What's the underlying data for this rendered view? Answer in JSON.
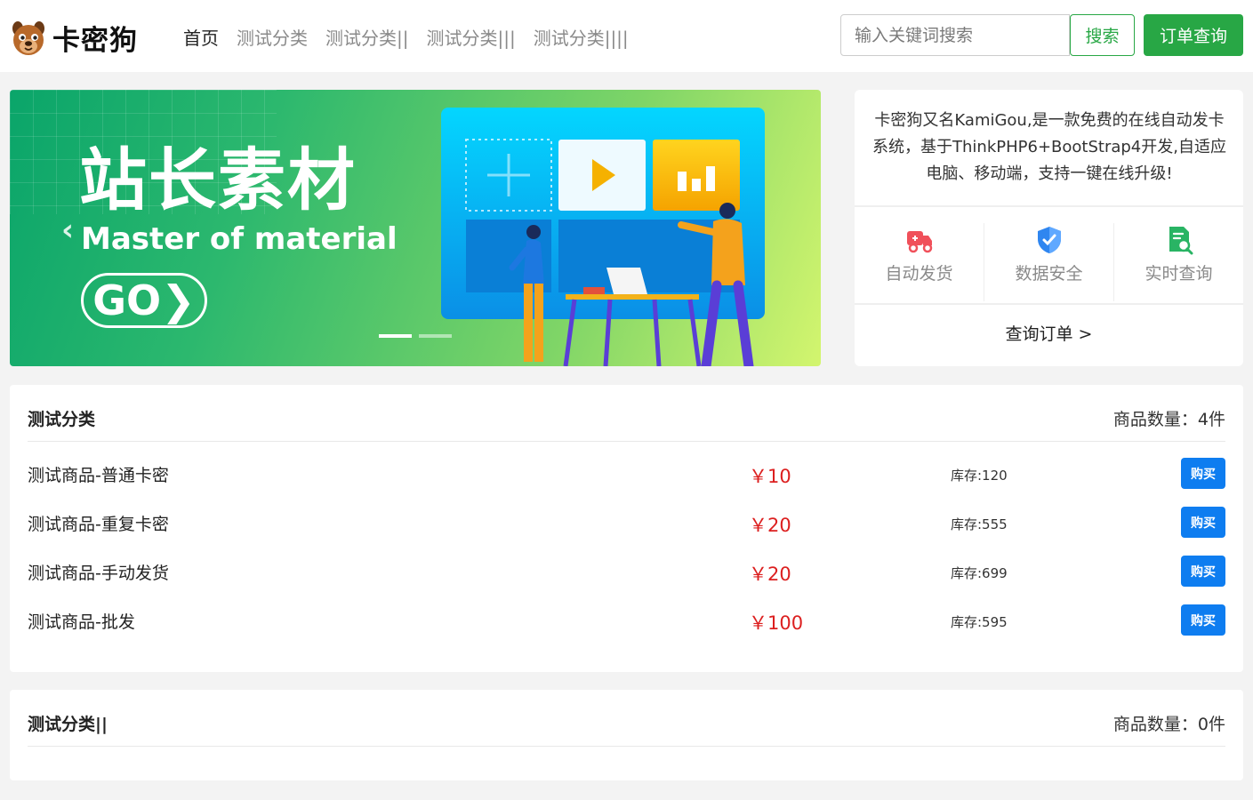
{
  "header": {
    "logo_text": "卡密狗",
    "nav": [
      "首页",
      "测试分类",
      "测试分类||",
      "测试分类|||",
      "测试分类||||"
    ],
    "search_placeholder": "输入关键词搜索",
    "search_label": "搜索",
    "order_query_label": "订单查询"
  },
  "banner": {
    "title": "站长素材",
    "subtitle": "Master of material",
    "go_label": "GO❯",
    "prev_label": "‹",
    "next_label": "›",
    "slide_count": 2,
    "active_slide": 0
  },
  "info": {
    "description": "卡密狗又名KamiGou,是一款免费的在线自动发卡系统，基于ThinkPHP6+BootStrap4开发,自适应电脑、移动端，支持一键在线升级!",
    "features": [
      {
        "label": "自动发货",
        "icon": "delivery-truck-icon"
      },
      {
        "label": "数据安全",
        "icon": "shield-check-icon"
      },
      {
        "label": "实时查询",
        "icon": "document-search-icon"
      }
    ],
    "query_link": "查询订单 >"
  },
  "colors": {
    "brand_green": "#28a745",
    "buy_blue": "#0e7df0",
    "price_red": "#dc1f1f",
    "truck_red": "#f0505a",
    "shield_blue": "#2f86f0",
    "doc_green": "#29b464"
  },
  "sections": [
    {
      "title": "测试分类",
      "count": "商品数量：4件",
      "products": [
        {
          "name": "测试商品-普通卡密",
          "price": "￥10",
          "stock": "库存:120",
          "buy": "购买"
        },
        {
          "name": "测试商品-重复卡密",
          "price": "￥20",
          "stock": "库存:555",
          "buy": "购买"
        },
        {
          "name": "测试商品-手动发货",
          "price": "￥20",
          "stock": "库存:699",
          "buy": "购买"
        },
        {
          "name": "测试商品-批发",
          "price": "￥100",
          "stock": "库存:595",
          "buy": "购买"
        }
      ]
    },
    {
      "title": "测试分类||",
      "count": "商品数量：0件",
      "products": []
    }
  ]
}
